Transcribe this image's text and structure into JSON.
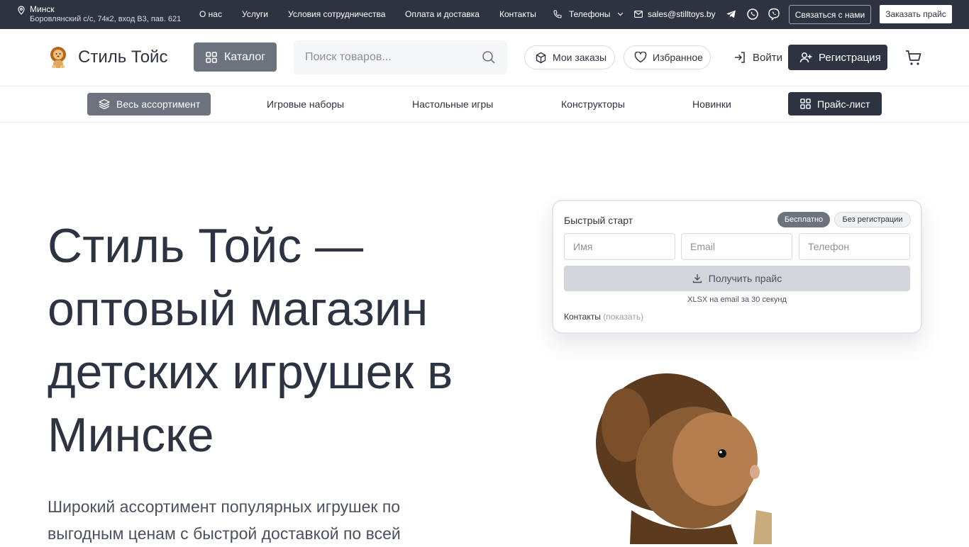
{
  "topbar": {
    "city": "Минск",
    "address": "Боровлянский с/с, 74к2, вход В3, пав. 621",
    "links": [
      "О нас",
      "Услуги",
      "Условия сотрудничества",
      "Оплата и доставка",
      "Контакты"
    ],
    "phones_label": "Телефоны",
    "email": "sales@stilltoys.by",
    "messengers": [
      "telegram-icon",
      "whatsapp-icon",
      "viber-icon"
    ],
    "contact_button": "Связаться с нами",
    "order_price_button": "Заказать прайс"
  },
  "header": {
    "logo_text": "Стиль Тойс",
    "catalog_button": "Каталог",
    "search_placeholder": "Поиск товаров...",
    "orders_label": "Мои заказы",
    "favorites_label": "Избранное",
    "login_label": "Войти",
    "register_label": "Регистрация"
  },
  "subnav": {
    "all_label": "Весь ассортимент",
    "items": [
      "Игровые наборы",
      "Настольные игры",
      "Конструкторы",
      "Новинки"
    ],
    "pricelist_label": "Прайс-лист"
  },
  "hero": {
    "title": "Стиль Тойс — оптовый магазин детских игрушек в Минске",
    "subtitle": "Широкий ассортимент популярных игрушек по выгодным ценам с быстрой доставкой по всей"
  },
  "quickstart": {
    "title": "Быстрый старт",
    "badge_free": "Бесплатно",
    "badge_noreg": "Без регистрации",
    "name_placeholder": "Имя",
    "email_placeholder": "Email",
    "phone_placeholder": "Телефон",
    "submit_label": "Получить прайс",
    "note": "XLSX на email за 30 секунд",
    "contacts_label": "Контакты",
    "contacts_show": "(показать)"
  },
  "colors": {
    "dark": "#2d3340",
    "gray_button": "#6c737f",
    "disabled_button": "#d2d5da"
  }
}
